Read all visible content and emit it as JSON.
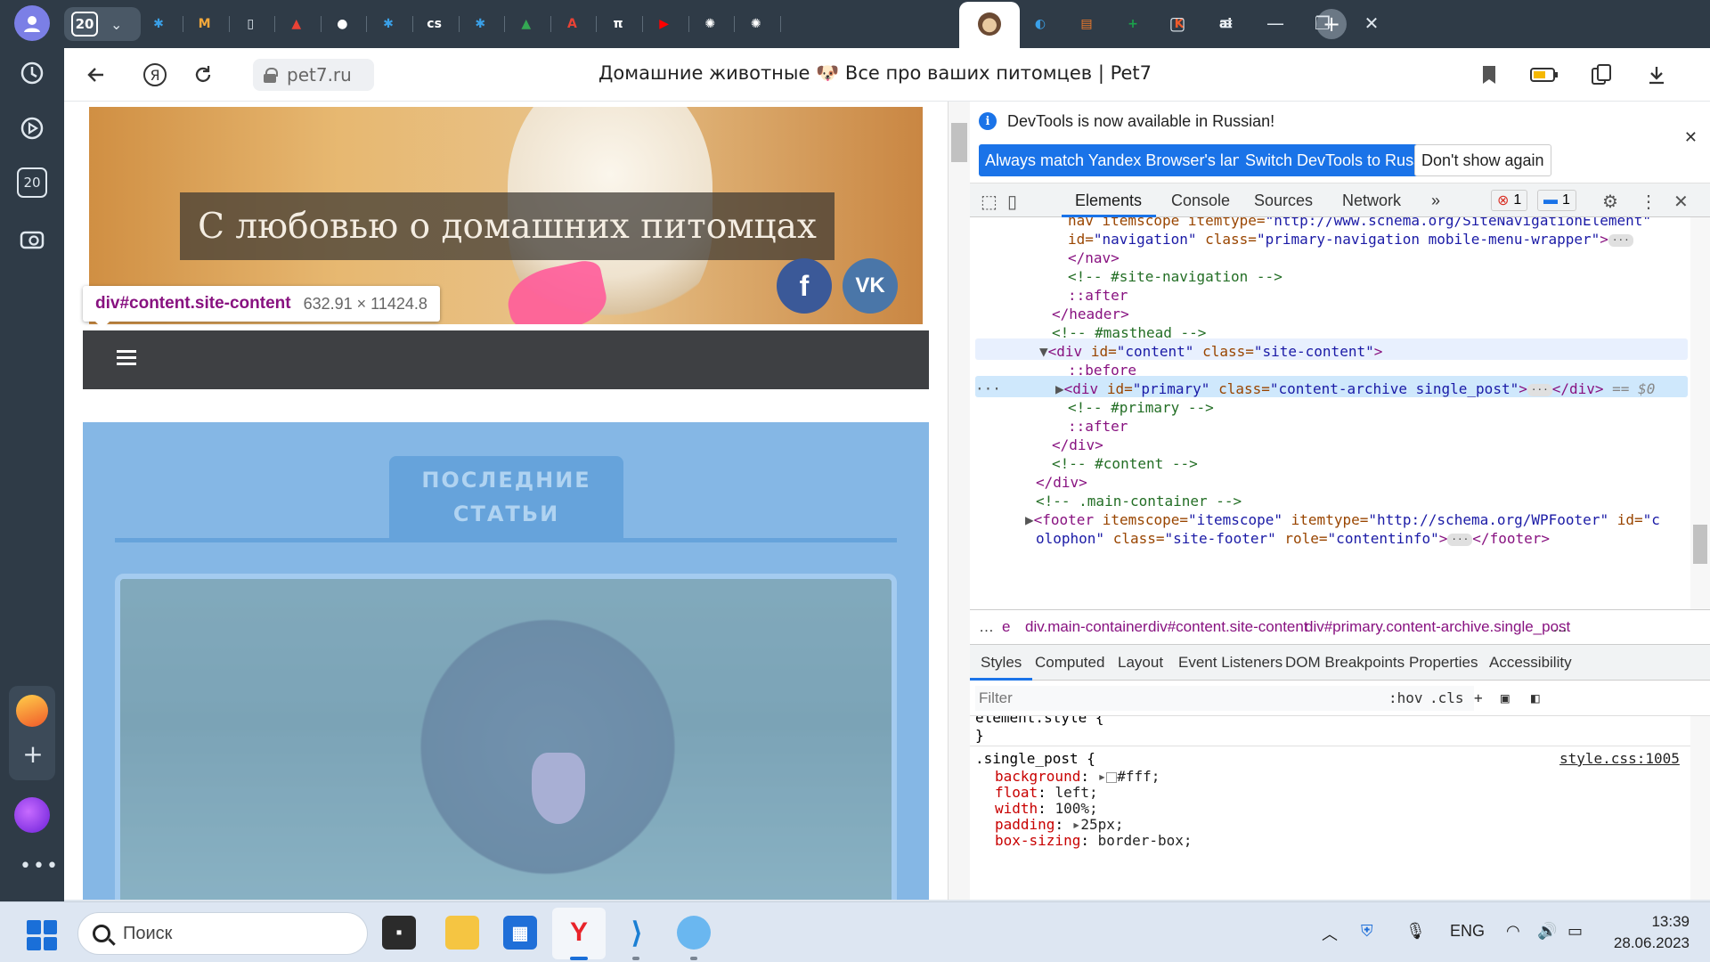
{
  "browser": {
    "tab_count": "20",
    "url_domain": "pet7.ru",
    "page_title": "Домашние животные 🐶 Все про ваших питомцев | Pet7",
    "tabs": [
      {
        "icon": "snowflake-icon",
        "color": "#3aa0e8"
      },
      {
        "icon": "m-letter-icon",
        "color": "#f3a83b"
      },
      {
        "icon": "document-icon",
        "color": "#dfe7ee"
      },
      {
        "icon": "pdf-icon",
        "color": "#e94235"
      },
      {
        "icon": "github-icon",
        "color": "#ffffff"
      },
      {
        "icon": "snowflake-icon",
        "color": "#3aa0e8"
      },
      {
        "icon": "cs-icon",
        "color": "#ffffff"
      },
      {
        "icon": "snowflake-icon",
        "color": "#3aa0e8"
      },
      {
        "icon": "google-drive-icon",
        "color": "#34a853"
      },
      {
        "icon": "translate-icon",
        "color": "#e94235"
      },
      {
        "icon": "pi-icon",
        "color": "#ffffff"
      },
      {
        "icon": "youtube-icon",
        "color": "#ff0000"
      },
      {
        "icon": "openai-icon",
        "color": "#ffffff"
      },
      {
        "icon": "openai-icon",
        "color": "#ffffff"
      }
    ],
    "tabs_after_active": [
      {
        "icon": "yandex-music-icon",
        "color": "#3aa0e8"
      },
      {
        "icon": "calendar-icon",
        "color": "#f37b2a"
      },
      {
        "icon": "plus-cross-icon",
        "color": "#1aa34a"
      },
      {
        "icon": "k-icon",
        "color": "#f05a2a"
      },
      {
        "icon": "ai-icon",
        "color": "#ffffff"
      }
    ]
  },
  "page": {
    "hero_caption": "С любовью о домашних питомцах",
    "facebook_label": "f",
    "vk_label": "VK",
    "latest_articles": "ПОСЛЕДНИЕ СТАТЬИ",
    "tooltip_selector": "div#content.site-content",
    "tooltip_size": "632.91 × 11424.8"
  },
  "devtools": {
    "info_message": "DevTools is now available in Russian!",
    "info_buttons": [
      "Always match Yandex Browser's language",
      "Switch DevTools to Russian",
      "Don't show again"
    ],
    "tabs": [
      "Elements",
      "Console",
      "Sources",
      "Network"
    ],
    "error_count": "1",
    "message_count": "1",
    "crumbs": [
      "e",
      "div.main-container",
      "div#content.site-content",
      "div#primary.content-archive.single_post"
    ],
    "panel_tabs": [
      "Styles",
      "Computed",
      "Layout",
      "Event Listeners",
      "DOM Breakpoints",
      "Properties",
      "Accessibility"
    ],
    "filter_placeholder": "Filter",
    "filter_tools": [
      ":hov",
      ".cls",
      "+"
    ],
    "element_style": "element.style {",
    "element_style_close": "}",
    "rule_selector": ".single_post {",
    "rule_source": "style.css:1005",
    "rule_props": [
      {
        "name": "background",
        "value": "#fff;"
      },
      {
        "name": "float",
        "value": "left;"
      },
      {
        "name": "width",
        "value": "100%;"
      },
      {
        "name": "padding",
        "value": "25px;"
      },
      {
        "name": "box-sizing",
        "value": "border-box;"
      }
    ]
  },
  "taskbar": {
    "search_placeholder": "Поиск",
    "lang": "ENG",
    "time": "13:39",
    "date": "28.06.2023"
  }
}
